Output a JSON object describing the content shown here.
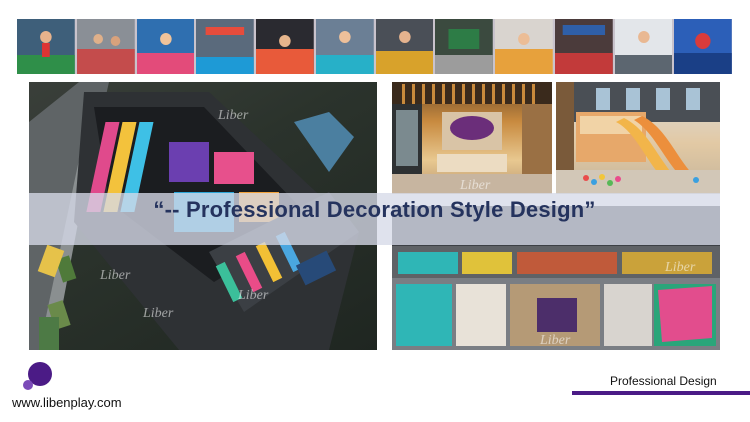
{
  "banner": {
    "title": "“-- Professional Decoration Style Design”"
  },
  "watermark": "Liber",
  "footer": {
    "website": "www.libenplay.com",
    "section_label": "Professional Design"
  },
  "colors": {
    "accent_purple": "#4b1b86",
    "title_navy": "#25335e"
  }
}
